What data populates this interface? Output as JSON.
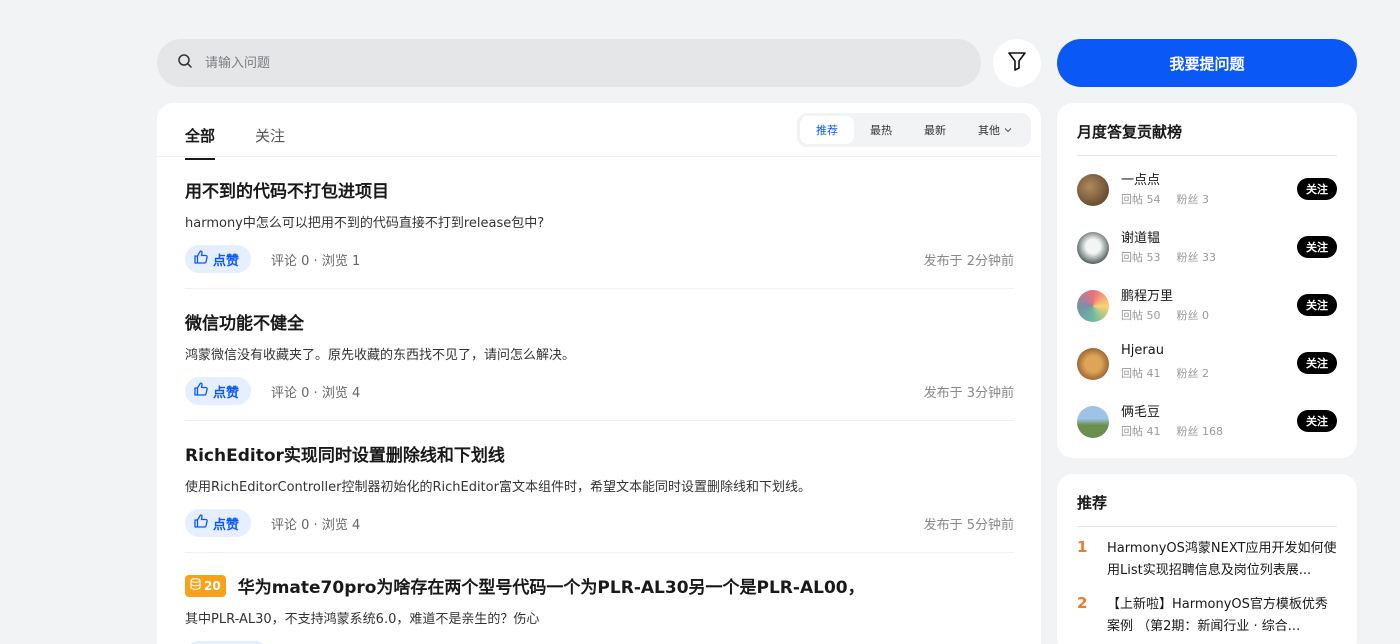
{
  "search": {
    "placeholder": "请输入问题"
  },
  "ask_button": "我要提问题",
  "tabs": [
    {
      "label": "全部"
    },
    {
      "label": "关注"
    }
  ],
  "sort_options": [
    {
      "label": "推荐"
    },
    {
      "label": "最热"
    },
    {
      "label": "最新"
    },
    {
      "label": "其他"
    }
  ],
  "posts": [
    {
      "title": "用不到的代码不打包进项目",
      "desc": "harmony中怎么可以把用不到的代码直接不打到release包中?",
      "like": "点赞",
      "comments": "评论 0",
      "views": "浏览 1",
      "time": "发布于 2分钟前"
    },
    {
      "title": "微信功能不健全",
      "desc": "鸿蒙微信没有收藏夹了。原先收藏的东西找不见了，请问怎么解决。",
      "like": "点赞",
      "comments": "评论 0",
      "views": "浏览 4",
      "time": "发布于 3分钟前"
    },
    {
      "title": "RichEditor实现同时设置删除线和下划线",
      "desc": "使用RichEditorController控制器初始化的RichEditor富文本组件时，希望文本能同时设置删除线和下划线。",
      "like": "点赞",
      "comments": "评论 0",
      "views": "浏览 4",
      "time": "发布于 5分钟前"
    },
    {
      "bounty": "20",
      "title": "华为mate70pro为啥存在两个型号代码一个为PLR-AL30另一个是PLR-AL00，",
      "desc": "其中PLR-AL30，不支持鸿蒙系统6.0，难道不是亲生的？伤心"
    }
  ],
  "ranking": {
    "title": "月度答复贡献榜",
    "follow_label": "关注",
    "users": [
      {
        "name": "一点点",
        "replies": "回帖 54",
        "fans": "粉丝 3"
      },
      {
        "name": "谢道韫",
        "replies": "回帖 53",
        "fans": "粉丝 33"
      },
      {
        "name": "鹏程万里",
        "replies": "回帖 50",
        "fans": "粉丝 0"
      },
      {
        "name": "Hjerau",
        "replies": "回帖 41",
        "fans": "粉丝 2"
      },
      {
        "name": "俩毛豆",
        "replies": "回帖 41",
        "fans": "粉丝 168"
      }
    ]
  },
  "recommend": {
    "title": "推荐",
    "items": [
      {
        "rank": "1",
        "text": "HarmonyOS鸿蒙NEXT应用开发如何使用List实现招聘信息及岗位列表展..."
      },
      {
        "rank": "2",
        "text": "【上新啦】HarmonyOS官方模板优秀案例 （第2期：新闻行业 · 综合..."
      }
    ]
  },
  "colors": {
    "primary": "#0a59f7",
    "rank": "#ee7b2b",
    "bounty": "#f7a21b"
  }
}
